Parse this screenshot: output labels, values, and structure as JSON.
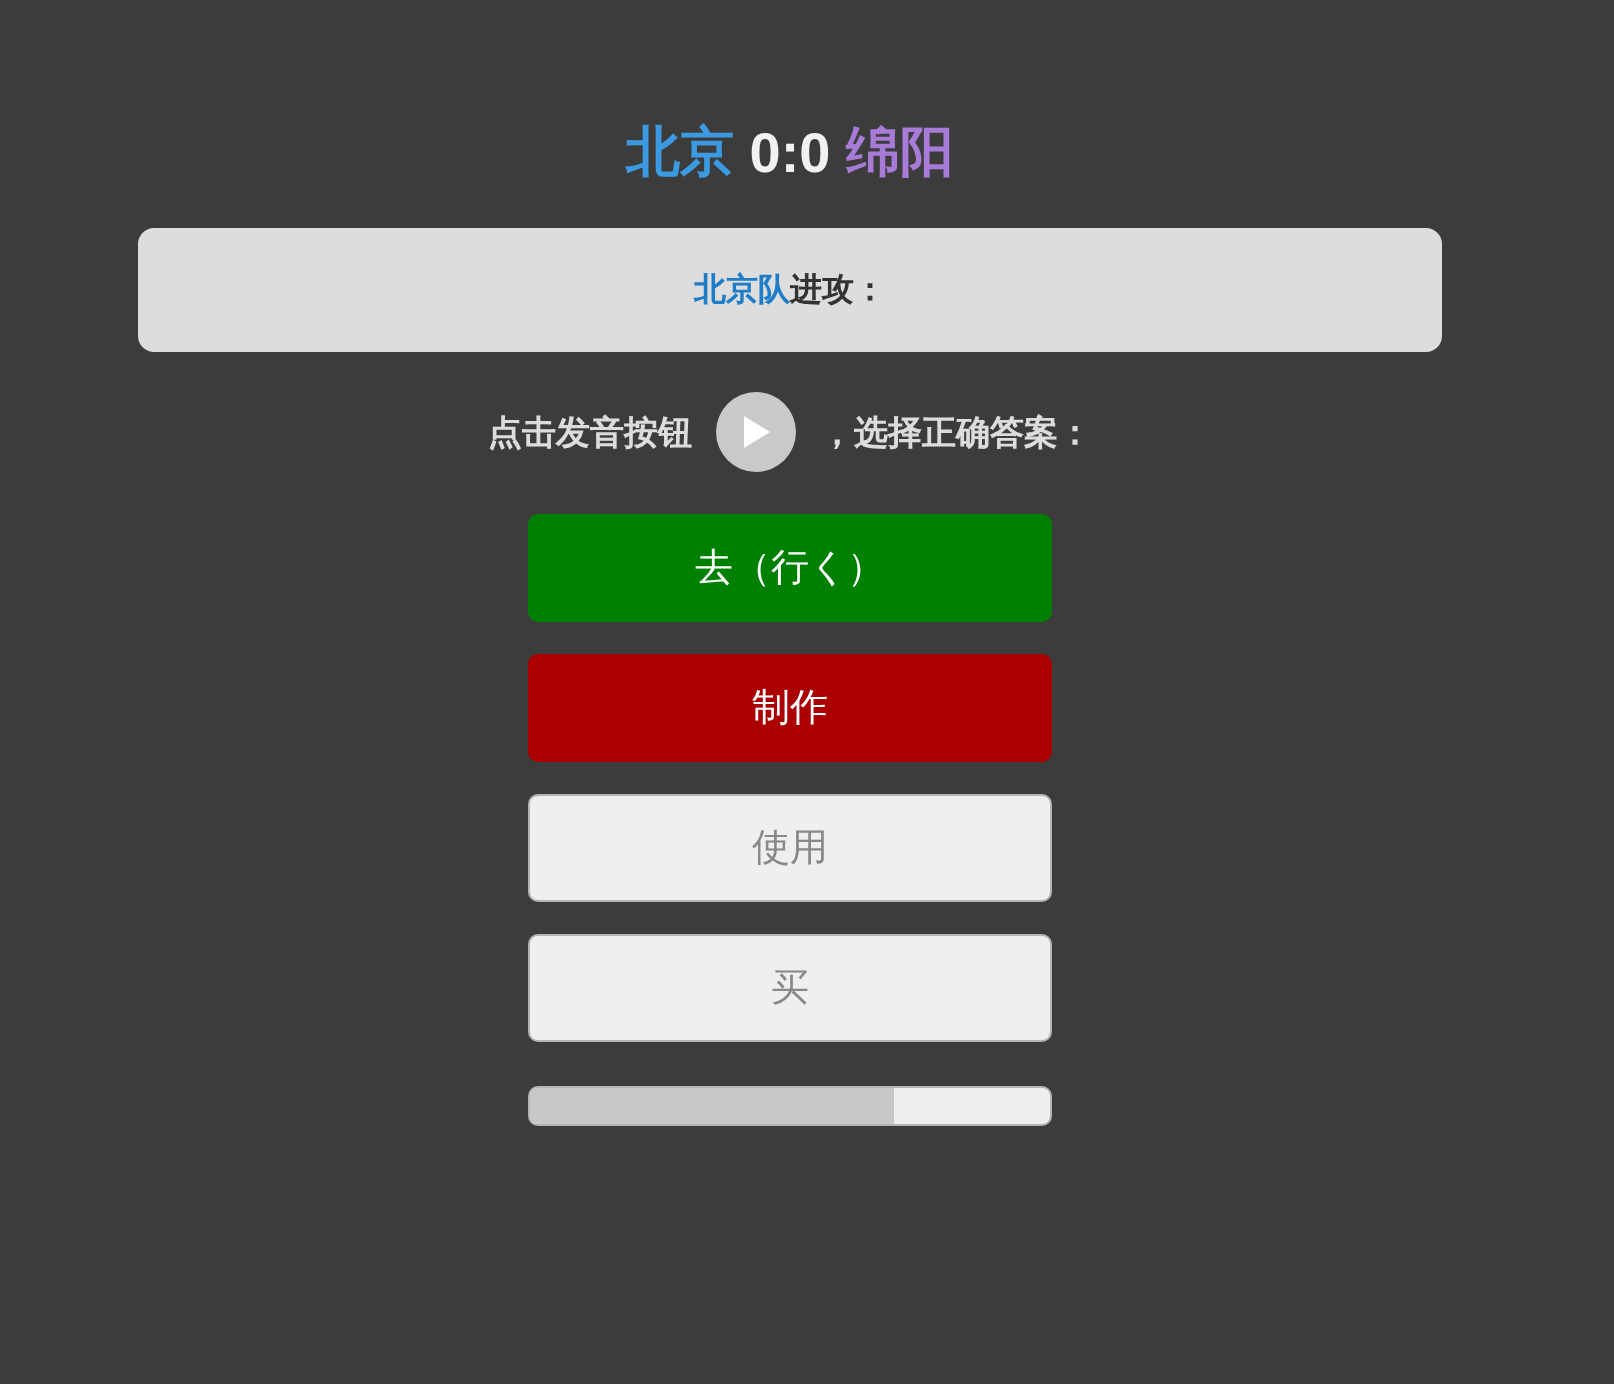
{
  "scoreboard": {
    "teams": [
      {
        "name": "北京",
        "color": "#3c9ae0"
      },
      {
        "name": "绵阳",
        "color": "#a87bd8"
      }
    ],
    "score": "0:0"
  },
  "attack_banner": {
    "team": "北京队",
    "label": "进攻："
  },
  "prompt": {
    "before": "点击发音按钮",
    "after": "，选择正确答案："
  },
  "answers": [
    {
      "label": "去（行く）",
      "kind": "correct"
    },
    {
      "label": "制作",
      "kind": "wrong"
    },
    {
      "label": "使用",
      "kind": "neutral"
    },
    {
      "label": "买",
      "kind": "neutral"
    }
  ],
  "progress": {
    "level": 0.7
  }
}
